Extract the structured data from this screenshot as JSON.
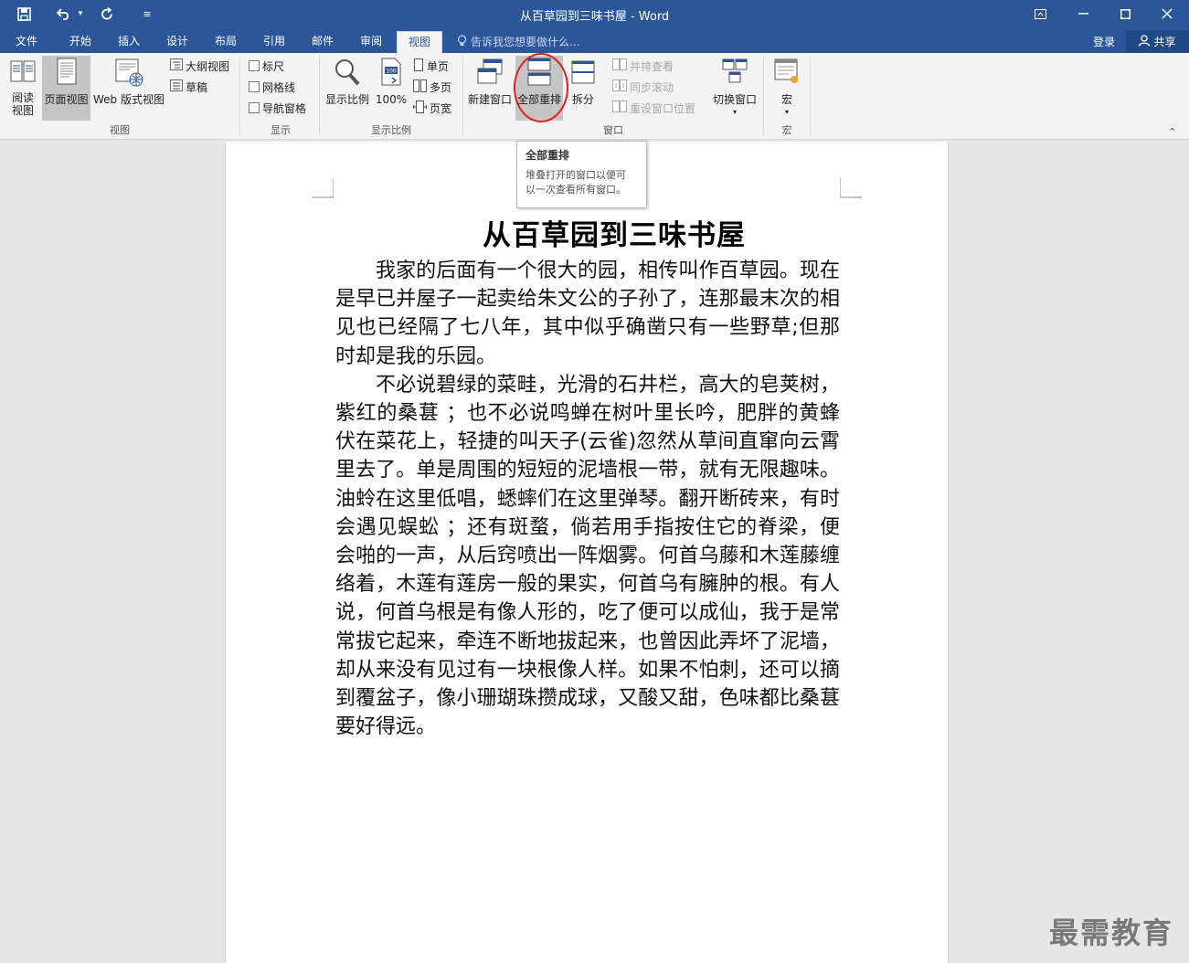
{
  "window": {
    "title": "从百草园到三味书屋 - Word"
  },
  "quick_access": {
    "save_icon": "save-icon",
    "undo_icon": "undo-icon",
    "redo_icon": "redo-icon",
    "customize_icon": "customize-icon"
  },
  "menu": {
    "tabs": [
      "文件",
      "开始",
      "插入",
      "设计",
      "布局",
      "引用",
      "邮件",
      "审阅",
      "视图"
    ],
    "active_tab": "视图",
    "tell_me": "告诉我您想要做什么...",
    "login": "登录",
    "share": "共享"
  },
  "ribbon": {
    "views": {
      "label": "视图",
      "read_mode": "阅读视图",
      "read_mode_line1": "阅读",
      "read_mode_line2": "视图",
      "print_layout": "页面视图",
      "web_layout": "Web 版式视图",
      "outline": "大纲视图",
      "draft": "草稿"
    },
    "show": {
      "label": "显示",
      "ruler": "标尺",
      "gridlines": "网格线",
      "nav_pane": "导航窗格"
    },
    "zoom": {
      "label": "显示比例",
      "zoom": "显示比例",
      "hundred": "100%",
      "one_page": "单页",
      "multi_page": "多页",
      "page_width": "页宽"
    },
    "window": {
      "label": "窗口",
      "new_window": "新建窗口",
      "arrange_all": "全部重排",
      "split": "拆分",
      "side_by_side": "并排查看",
      "sync_scroll": "同步滚动",
      "reset_position": "重设窗口位置",
      "switch_windows": "切换窗口"
    },
    "macros": {
      "label": "宏",
      "macros": "宏"
    }
  },
  "tooltip": {
    "title": "全部重排",
    "description_line1": "堆叠打开的窗口以便可",
    "description_line2": "以一次查看所有窗口。"
  },
  "document": {
    "title": "从百草园到三味书屋",
    "paragraphs": [
      "我家的后面有一个很大的园，相传叫作百草园。现在是早已并屋子一起卖给朱文公的子孙了，连那最末次的相见也已经隔了七八年，其中似乎确凿只有一些野草;但那时却是我的乐园。",
      "不必说碧绿的菜畦，光滑的石井栏，高大的皂荚树，紫红的桑葚 ；也不必说鸣蝉在树叶里长吟，肥胖的黄蜂伏在菜花上，轻捷的叫天子(云雀)忽然从草间直窜向云霄里去了。单是周围的短短的泥墙根一带，就有无限趣味。油蛉在这里低唱，蟋蟀们在这里弹琴。翻开断砖来，有时会遇见蜈蚣 ；还有斑蝥，倘若用手指按住它的脊梁，便会啪的一声，从后窍喷出一阵烟雾。何首乌藤和木莲藤缠络着，木莲有莲房一般的果实，何首乌有臃肿的根。有人说，何首乌根是有像人形的，吃了便可以成仙，我于是常常拔它起来，牵连不断地拔起来，也曾因此弄坏了泥墙，却从来没有见过有一块根像人样。如果不怕刺，还可以摘到覆盆子，像小珊瑚珠攒成球，又酸又甜，色味都比桑葚要好得远。"
    ]
  },
  "watermark": "最需教育"
}
